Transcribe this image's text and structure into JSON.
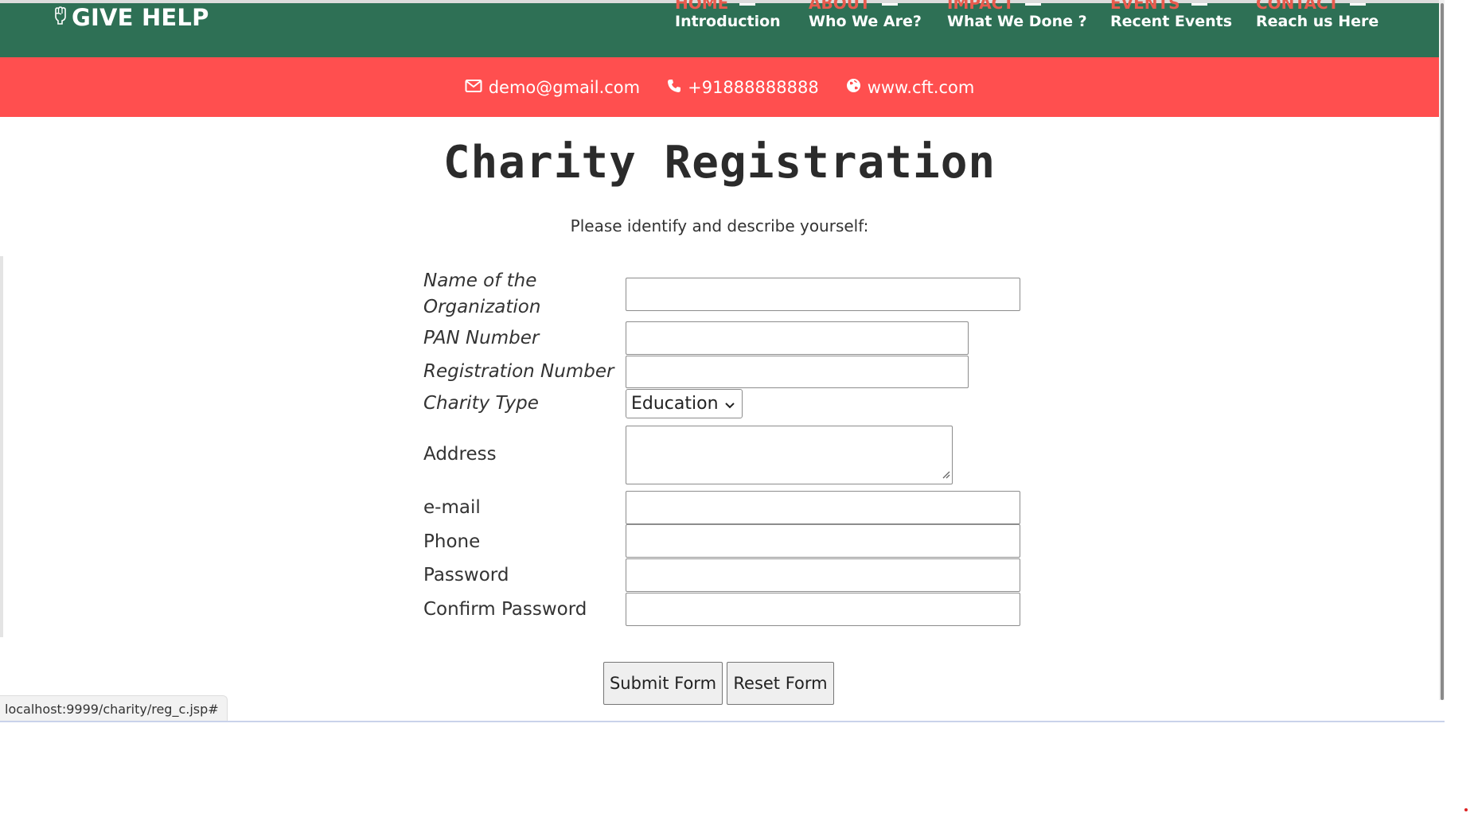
{
  "brand": {
    "name": "GIVE HELP",
    "icon": "raised-fist-icon"
  },
  "nav": [
    {
      "top": "HOME",
      "sub": "Introduction"
    },
    {
      "top": "ABOUT",
      "sub": "Who We Are?"
    },
    {
      "top": "IMPACT",
      "sub": "What We Done ?"
    },
    {
      "top": "EVENTS",
      "sub": "Recent Events"
    },
    {
      "top": "CONTACT",
      "sub": "Reach us Here"
    }
  ],
  "contact_bar": {
    "email": "demo@gmail.com",
    "phone": "+91888888888",
    "website": "www.cft.com",
    "icons": [
      "envelope-icon",
      "phone-icon",
      "globe-icon"
    ]
  },
  "page": {
    "title": "Charity Registration",
    "subtitle": "Please identify and describe yourself:"
  },
  "form": {
    "labels": {
      "org_name_line1": "Name of the",
      "org_name_line2": "Organization",
      "pan": "PAN Number",
      "registration": "Registration Number",
      "charity_type": "Charity Type",
      "address": "Address",
      "email": "e-mail",
      "phone": "Phone",
      "password": "Password",
      "confirm_password": "Confirm Password"
    },
    "values": {
      "org_name": "",
      "pan": "",
      "registration": "",
      "charity_type": "Education",
      "address": "",
      "email": "",
      "phone": "",
      "password": "",
      "confirm_password": ""
    },
    "buttons": {
      "submit": "Submit Form",
      "reset": "Reset Form"
    }
  },
  "status_bar": {
    "url": "localhost:9999/charity/reg_c.jsp#"
  },
  "colors": {
    "navbar": "#2e7055",
    "infobar": "#ff4f4f",
    "nav_top_text": "#e85b4e"
  }
}
